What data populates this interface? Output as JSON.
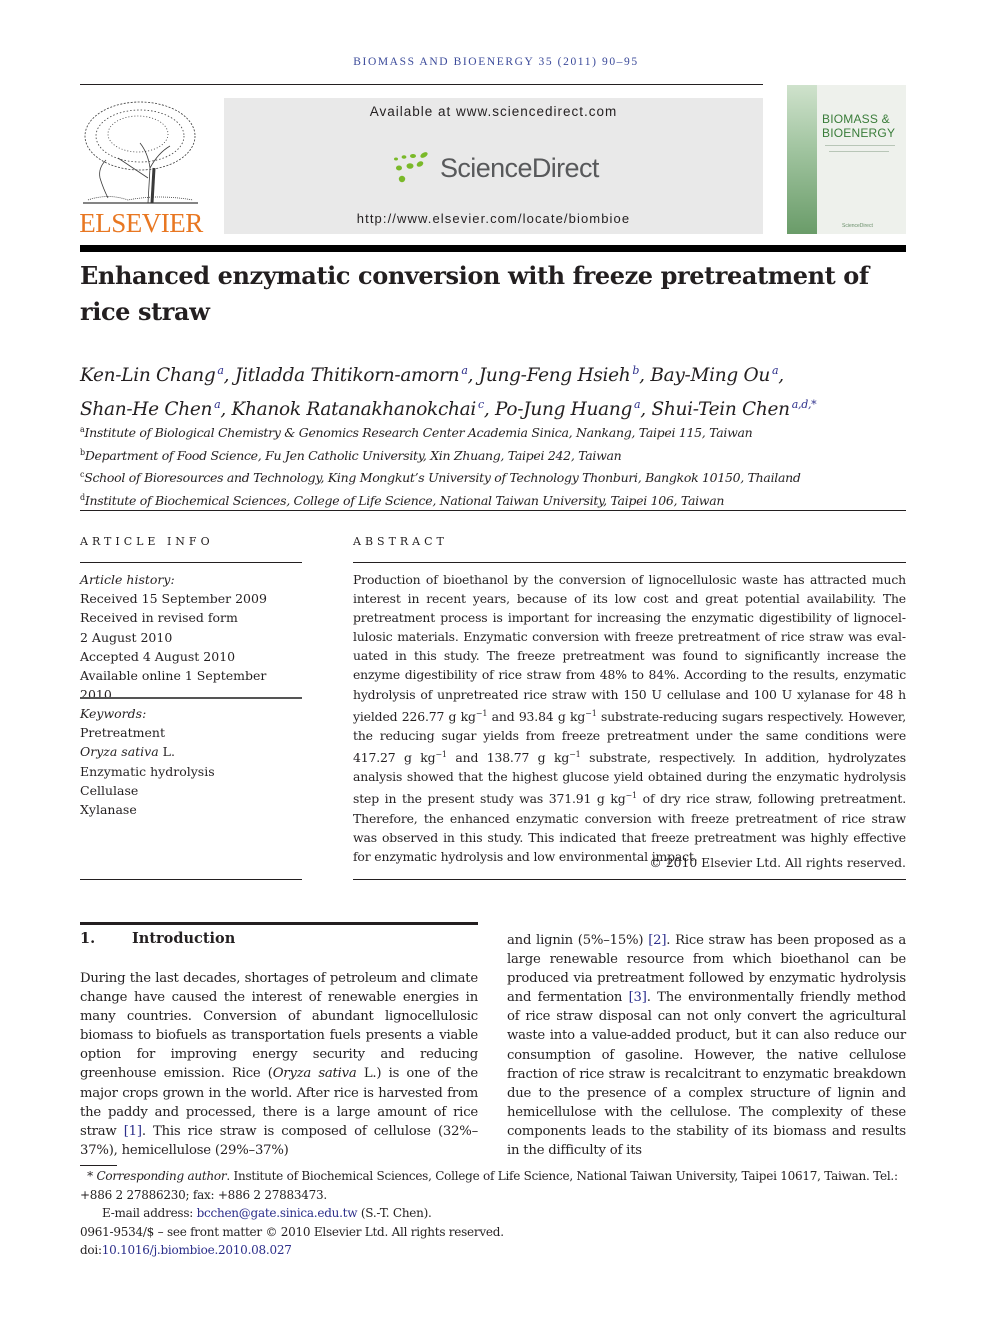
{
  "journal_header": "BIOMASS AND BIOENERGY 35 (2011) 90–95",
  "publisher": {
    "name": "ELSEVIER",
    "available_at": "Available at www.sciencedirect.com",
    "sciencedirect_name": "ScienceDirect",
    "journal_url": "http://www.elsevier.com/locate/biombioe",
    "brand_color": "#e87722"
  },
  "cover": {
    "title_line1": "BIOMASS &",
    "title_line2": "BIOENERGY",
    "footer": "ScienceDirect"
  },
  "article": {
    "title": "Enhanced enzymatic conversion with freeze pretreatment of rice straw",
    "authors": [
      {
        "name": "Ken-Lin Chang",
        "aff": "a",
        "sep": ", "
      },
      {
        "name": "Jitladda Thitikorn-amorn",
        "aff": "a",
        "sep": ", "
      },
      {
        "name": "Jung-Feng Hsieh",
        "aff": "b",
        "sep": ", "
      },
      {
        "name": "Bay-Ming Ou",
        "aff": "a",
        "sep": ","
      },
      {
        "name": "Shan-He Chen",
        "aff": "a",
        "sep": ", "
      },
      {
        "name": "Khanok Ratanakhanokchai",
        "aff": "c",
        "sep": ", "
      },
      {
        "name": "Po-Jung Huang",
        "aff": "a",
        "sep": ", "
      },
      {
        "name": "Shui-Tein Chen",
        "aff": "a,d,*",
        "sep": ""
      }
    ],
    "affiliations": [
      {
        "mark": "a",
        "text": "Institute of Biological Chemistry & Genomics Research Center Academia Sinica, Nankang, Taipei 115, Taiwan"
      },
      {
        "mark": "b",
        "text": "Department of Food Science, Fu Jen Catholic University, Xin Zhuang, Taipei 242, Taiwan"
      },
      {
        "mark": "c",
        "text": "School of Bioresources and Technology, King Mongkut’s University of Technology Thonburi, Bangkok 10150, Thailand"
      },
      {
        "mark": "d",
        "text": "Institute of Biochemical Sciences, College of Life Science, National Taiwan University, Taipei 106, Taiwan"
      }
    ]
  },
  "article_info": {
    "heading": "ARTICLE INFO",
    "history_label": "Article history:",
    "history": [
      "Received 15 September 2009",
      "Received in revised form",
      "2 August 2010",
      "Accepted 4 August 2010",
      "Available online 1 September 2010"
    ],
    "keywords_label": "Keywords:",
    "keywords": [
      {
        "text": "Pretreatment",
        "italic": "",
        "rest": ""
      },
      {
        "text": "",
        "italic": "Oryza sativa",
        "rest": " L."
      },
      {
        "text": "Enzymatic hydrolysis",
        "italic": "",
        "rest": ""
      },
      {
        "text": "Cellulase",
        "italic": "",
        "rest": ""
      },
      {
        "text": "Xylanase",
        "italic": "",
        "rest": ""
      }
    ]
  },
  "abstract": {
    "heading": "ABSTRACT",
    "p1": "Production of bioethanol by the conversion of lignocellulosic waste has attracted much interest in recent years, because of its low cost and great potential availability. The pretreatment process is important for increasing the enzymatic digestibility of lignocel­lulosic materials. Enzymatic conversion with freeze pretreatment of rice straw was eval­uated in this study. The freeze pretreatment was found to significantly increase the enzyme digestibility of rice straw from 48% to 84%. According to the results, enzymatic hydrolysis of unpretreated rice straw with 150 U cellulase and 100 U xylanase for 48 h yielded 226.77 g kg",
    "p2": " and 93.84 g kg",
    "p3": " substrate-reducing sugars respectively. However, the reducing sugar yields from freeze pretreatment under the same conditions were 417.27 g kg",
    "p4": " and 138.77 g kg",
    "p5": " substrate, respectively. In addition, hydrolyzates analysis showed that the highest glucose yield obtained during the enzymatic hydrolysis step in the present study was 371.91 g kg",
    "p6": " of dry rice straw, following pretreatment. Therefore, the enhanced enzymatic conversion with freeze pretreatment of rice straw was observed in this study. This indicated that freeze pretreatment was highly effective for enzymatic hydrolysis and low environmental impact.",
    "exp": "−1",
    "copyright": "© 2010 Elsevier Ltd. All rights reserved."
  },
  "introduction": {
    "number": "1.",
    "heading": "Introduction",
    "left_a": "During the last decades, shortages of petroleum and climate change have caused the interest of renewable energies in many countries. Conversion of abundant lignocellulosic biomass to biofuels as transportation fuels presents a viable option for improving energy security and reducing greenhouse emission. Rice (",
    "left_italic": "Oryza sativa",
    "left_b": " L.) is one of the major crops grown in the world. After rice is harvested from the paddy and processed, there is a large amount of rice straw ",
    "ref1": "[1]",
    "left_c": ". This rice straw is composed of cellulose (32%–37%), hemicellulose (29%–37%)",
    "right_a": "and lignin (5%–15%) ",
    "ref2": "[2]",
    "right_b": ". Rice straw has been proposed as a large renewable resource from which bioethanol can be produced via pretreatment followed by enzymatic hydrolysis and fermentation ",
    "ref3": "[3]",
    "right_c": ". The environmentally friendly method of rice straw disposal can not only convert the agricultural waste into a value-added product, but it can also reduce our consumption of gasoline. However, the native cellulose fraction of rice straw is recalcitrant to enzymatic breakdown due to the presence of a complex structure of lignin and hemicellulose with the cellulose. The complexity of these components leads to the stability of its biomass and results in the difficulty of its"
  },
  "footnotes": {
    "star": "*",
    "corr_label": "Corresponding author",
    "corr_text": ". Institute of Biochemical Sciences, College of Life Science, National Taiwan University, Taipei 10617, Taiwan. Tel.: +886 2 27886230; fax: +886 2 27883473.",
    "email_label": "E-mail address: ",
    "email": "bcchen@gate.sinica.edu.tw",
    "email_suffix": " (S.-T. Chen).",
    "issn": "0961-9534/$ – see front matter © 2010 Elsevier Ltd. All rights reserved.",
    "doi_label": "doi:",
    "doi": "10.1016/j.biombioe.2010.08.027"
  },
  "colors": {
    "link": "#2b2d8a",
    "journal_header": "#3b4a9a",
    "sciencedirect_green": "#7ab929"
  }
}
